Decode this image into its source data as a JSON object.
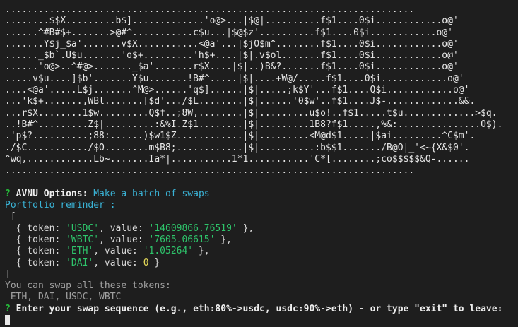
{
  "ascii_art": [
    "..........................................................................",
    "........$$X.........b$].............'o@>...|$@|..........f$1....0$i............o@'",
    "......^#B#$+.......>@#^...........c$u...|$@$z'..........f$1....0$i............o@'",
    ".......Y$j_$a'.......v$X...........<@a'...|$jO$m^........f$1....0$i............o@'",
    "......_$b`.U$u.......'o$+.........'h$+....|$|.v$ol.......f$1....0$i............o@'",
    "......'o@>..^#@>......._$a'.......r$X....|$|..)B&?.......f$1....0$i............o@'",
    ".....v$u....]$b'.......Y$u.......!B#^.....|$|....+W@/.....f$1....0$i............o@'",
    "....<@a'.....L$j.......^M@>......'q$]......|$|.....;k$Y'...f$1....Q$i............o@'",
    "...'k$+.......,WBl.......[$d'.../$L........|$|......'0$w'..f$1....J$-.............&&.",
    "...r$X........1$w.........Q$f..;8W,........|$|.........u$o!..f$1.....t$u.............>$q.",
    "..!B#^.........Z$|.........:&%I.Z$1........|$|.........1B8?f$1.....,%&:...............O$).",
    ".'p$?..........;88:......)$w1$Z............|$|.........<M@d$1.....|$ai.........^C$m'.",
    "./$C.........../$O........m$B8;............|$|..........:b$$1......./B@O|_'<~{X&$0'.",
    "^wq,............Lb~.......Ia*|...........1*1...........'C*[........;co$$$$$&Q-......",
    ".........................................................................."
  ],
  "prompt": {
    "marker": "?",
    "label": "AVNU Options:",
    "answer": "Make a batch of swaps"
  },
  "portfolio": {
    "heading": "Portfolio reminder :",
    "open_bracket": " [",
    "close_bracket": "]",
    "entries": [
      {
        "prefix": "  { token: ",
        "token": "'USDC'",
        "mid": ", value: ",
        "value": "'14609866.76519'",
        "suffix": " },"
      },
      {
        "prefix": "  { token: ",
        "token": "'WBTC'",
        "mid": ", value: ",
        "value": "'7605.06615'",
        "suffix": " },"
      },
      {
        "prefix": "  { token: ",
        "token": "'ETH'",
        "mid": ", value: ",
        "value": "'1.05264'",
        "suffix": " },"
      },
      {
        "prefix": "  { token: ",
        "token": "'DAI'",
        "mid": ", value: ",
        "value": "0",
        "suffix": " }"
      }
    ]
  },
  "swap_hint": {
    "title": "You can swap all these tokens:",
    "tokens": " ETH, DAI, USDC, WBTC"
  },
  "input_prompt": {
    "marker": "?",
    "text": "Enter your swap sequence (e.g., eth:80%->usdc, usdc:90%->eth) - or type \"exit\" to leave:"
  },
  "colors": {
    "background": "#1e1e1e",
    "question_marker": "#25c43b",
    "cyan": "#3ab3d6",
    "string_green": "#2ec46b",
    "number_yellow": "#e8dd5a"
  }
}
